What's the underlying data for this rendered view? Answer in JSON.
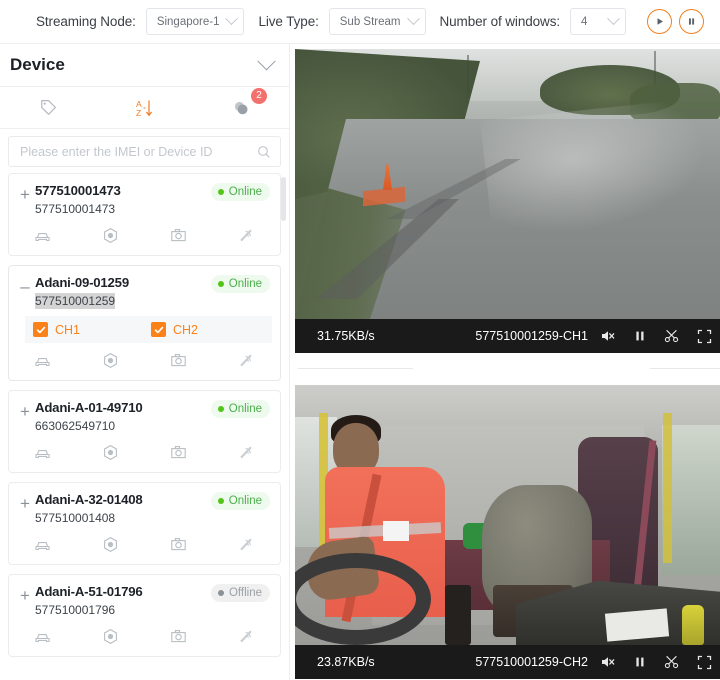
{
  "topbar": {
    "streaming_node_label": "Streaming Node:",
    "streaming_node_value": "Singapore-1",
    "live_type_label": "Live Type:",
    "live_type_value": "Sub Stream",
    "windows_label": "Number of windows:",
    "windows_value": "4",
    "play_button": "play-all",
    "pause_button": "pause-all"
  },
  "sidebar": {
    "title": "Device",
    "tools": [
      {
        "name": "tag-icon",
        "badge": ""
      },
      {
        "name": "sort-alpha-icon",
        "badge": ""
      },
      {
        "name": "group-icon",
        "badge": "2"
      }
    ],
    "search": {
      "placeholder": "Please enter the IMEI or Device ID",
      "value": ""
    },
    "devices": [
      {
        "expander": "+",
        "name": "577510001473",
        "id": "577510001473",
        "id_highlighted": false,
        "status": "Online",
        "expanded": false,
        "channels": []
      },
      {
        "expander": "–",
        "name": "Adani-09-01259",
        "id": "577510001259",
        "id_highlighted": true,
        "status": "Online",
        "expanded": true,
        "channels": [
          {
            "label": "CH1",
            "checked": true
          },
          {
            "label": "CH2",
            "checked": true
          }
        ]
      },
      {
        "expander": "+",
        "name": "Adani-A-01-49710",
        "id": "663062549710",
        "id_highlighted": false,
        "status": "Online",
        "expanded": false,
        "channels": []
      },
      {
        "expander": "+",
        "name": "Adani-A-32-01408",
        "id": "577510001408",
        "id_highlighted": false,
        "status": "Online",
        "expanded": false,
        "channels": []
      },
      {
        "expander": "+",
        "name": "Adani-A-51-01796",
        "id": "577510001796",
        "id_highlighted": false,
        "status": "Offline",
        "expanded": false,
        "channels": []
      }
    ],
    "device_actions": [
      "vehicle-icon",
      "location-icon",
      "camera-icon",
      "signal-icon"
    ]
  },
  "players": [
    {
      "speed": "31.75KB/s",
      "channel_name": "577510001259-CH1",
      "muted": true,
      "paused": false,
      "overlay_top": "",
      "overlay_bottom": "",
      "controls": [
        "mute-icon",
        "pause-icon",
        "clip-icon",
        "fullscreen-icon"
      ]
    },
    {
      "speed": "23.87KB/s",
      "channel_name": "577510001259-CH2",
      "muted": true,
      "paused": false,
      "overlay_top": "",
      "overlay_bottom": "",
      "controls": [
        "mute-icon",
        "pause-icon",
        "clip-icon",
        "fullscreen-icon"
      ]
    }
  ],
  "colors": {
    "accent_orange": "#fa8219",
    "online_green": "#52c41a",
    "offline_grey": "#8c9196",
    "badge_red": "#f4706c",
    "player_bar": "#1a1a1a"
  }
}
